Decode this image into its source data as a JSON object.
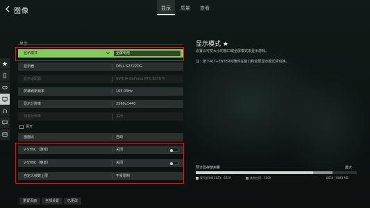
{
  "header": {
    "title": "图像",
    "tabs": [
      {
        "label": "显示",
        "active": true
      },
      {
        "label": "质量",
        "active": false
      },
      {
        "label": "查看",
        "active": false
      }
    ]
  },
  "rail": [
    "star-icon",
    "phone-icon",
    "controller-icon",
    "display-icon",
    "headphones-icon",
    "chat-icon",
    "card-icon"
  ],
  "settings": {
    "section": "显示",
    "rows": [
      {
        "label": "显示模式",
        "value": "全屏专用",
        "control": "dropdown",
        "selected": true
      },
      {
        "label": "显示器",
        "value": "DELL S2722DG",
        "control": "dropdown"
      },
      {
        "label": "显示适配器",
        "value": "NVIDIA GeForce RTX 3070 Ti",
        "control": "dropdown",
        "dim": true
      },
      {
        "label": "屏幕刷新频率",
        "value": "165.00Hz",
        "control": "dropdown"
      },
      {
        "label": "显示分辨率",
        "value": "2560x1440",
        "control": "dropdown"
      },
      {
        "label": "动态分辨率",
        "value": "关闭",
        "control": "dropdown",
        "dim": true
      },
      {
        "label": "画面比",
        "value": "自动",
        "control": "dropdown"
      },
      {
        "label": "V-SYNC（游戏）",
        "value": "关闭",
        "control": "toggle"
      },
      {
        "label": "V-SYNC（菜单）",
        "value": "关闭",
        "control": "toggle"
      },
      {
        "label": "自定义帧数上限",
        "value": "不受限制",
        "control": "dropdown"
      }
    ],
    "expand_label": "展开"
  },
  "detail": {
    "title": "显示模式 ★",
    "text1": "设置以可变大小的窗口或全屏模式来显示游戏。",
    "text2": "注：按下ALT+ENTER可随时在窗口和全屏显示模式间切换。"
  },
  "vram": {
    "label": "预计显存使用量",
    "max_label": "最大",
    "game_label": "现代战争Ⅲ 2023：6629",
    "other_label": "其他应用：1100",
    "total": "6634 | 8043 MB",
    "game_fraction": 0.73,
    "other_fraction": 0.12
  },
  "footer": {
    "buttons": [
      "重置页面",
      "全部设置",
      "已更改"
    ]
  },
  "colors": {
    "accent": "#86c95d",
    "highlight_box": "#b8242a"
  }
}
